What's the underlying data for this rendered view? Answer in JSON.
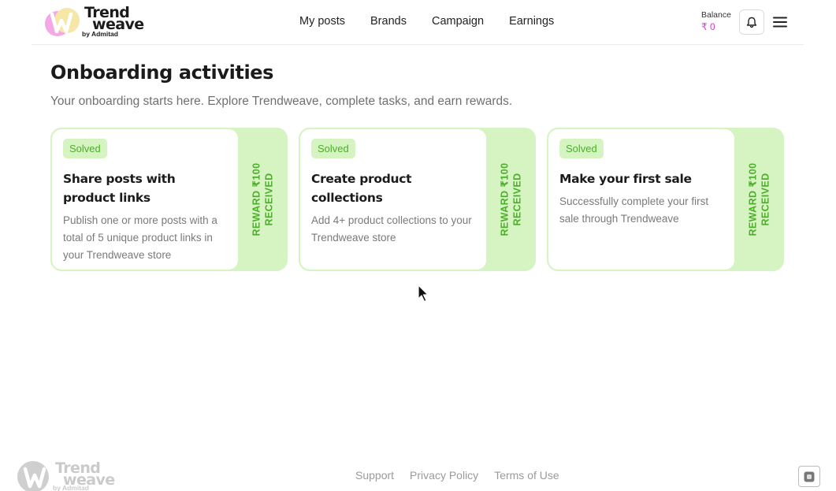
{
  "brand": {
    "name_line1": "Trend",
    "name_line2": "weave",
    "tagline": "by Admitad",
    "accent_pink": "#f5a8e6",
    "accent_yellow": "#f5e7a8"
  },
  "nav": {
    "items": [
      {
        "label": "My posts"
      },
      {
        "label": "Brands"
      },
      {
        "label": "Campaign"
      },
      {
        "label": "Earnings"
      }
    ]
  },
  "balance": {
    "label": "Balance",
    "value": "₹ 0",
    "color": "#d63cc8"
  },
  "icons": {
    "notifications": "bell-icon",
    "menu": "hamburger-menu-icon",
    "footer": "widget-icon"
  },
  "page": {
    "title": "Onboarding activities",
    "subtitle": "Your onboarding starts here. Explore Trendweave, complete tasks, and earn rewards."
  },
  "cards": [
    {
      "badge": "Solved",
      "title": "Share posts with product links",
      "description": "Publish one or more posts with a total of 5 unique product links in your Trendweave store",
      "reward_line1": "REWARD ₹100",
      "reward_line2": "RECEIVED"
    },
    {
      "badge": "Solved",
      "title": "Create product collections",
      "description": "Add 4+ product collections to your Trendweave store",
      "reward_line1": "REWARD ₹100",
      "reward_line2": "RECEIVED"
    },
    {
      "badge": "Solved",
      "title": "Make your first sale",
      "description": "Successfully complete your first sale through Trendweave",
      "reward_line1": "REWARD ₹100",
      "reward_line2": "RECEIVED"
    }
  ],
  "colors": {
    "success_green": "#4caf2a",
    "card_tint": "#d6f3c2"
  },
  "footer": {
    "links": [
      {
        "label": "Support"
      },
      {
        "label": "Privacy Policy"
      },
      {
        "label": "Terms of Use"
      }
    ]
  }
}
